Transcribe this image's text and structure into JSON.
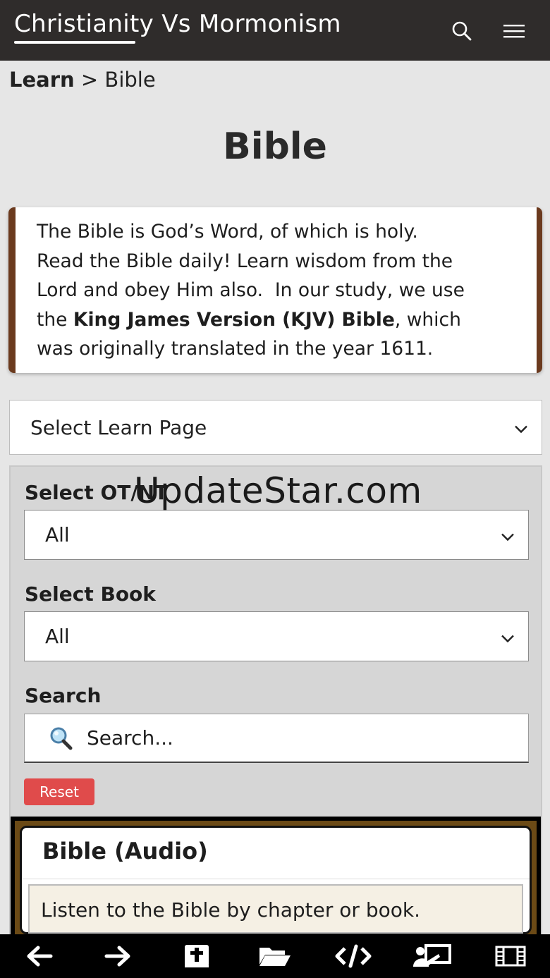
{
  "header": {
    "site_title": "Christianity Vs Mormonism",
    "search_icon": "search-icon",
    "menu_icon": "hamburger-menu-icon"
  },
  "breadcrumb": {
    "root": "Learn",
    "separator": ">",
    "current": "Bible"
  },
  "page_title": "Bible",
  "intro": {
    "line1": "The Bible is God’s Word, of which is holy.",
    "line2": "Read the Bible daily! Learn wisdom from the",
    "line3": "Lord and obey Him also.  In our study, we use",
    "line4_pre": "the ",
    "line4_bold": "King James Version (KJV) Bible",
    "line4_post": ", which",
    "line5": "was originally translated in the year 1611."
  },
  "learn_page_select": {
    "value": "Select Learn Page"
  },
  "filters": {
    "testament_label": "Select OT/NT",
    "testament_value": "All",
    "book_label": "Select Book",
    "book_value": "All",
    "search_label": "Search",
    "search_placeholder": "Search...",
    "reset_label": "Reset"
  },
  "audio_card": {
    "title": "Bible (Audio)",
    "description": "Listen to the Bible by chapter or book."
  },
  "watermark": "UpdateStar.com",
  "bottom_nav": [
    "back-arrow-icon",
    "forward-arrow-icon",
    "bible-cross-icon",
    "folder-open-icon",
    "code-icon",
    "presentation-icon",
    "film-icon"
  ],
  "colors": {
    "header_bg": "#2f2c2b",
    "accent_brown": "#6b3a1e",
    "reset_red": "#e04b4b",
    "nav_bg": "#000000"
  }
}
